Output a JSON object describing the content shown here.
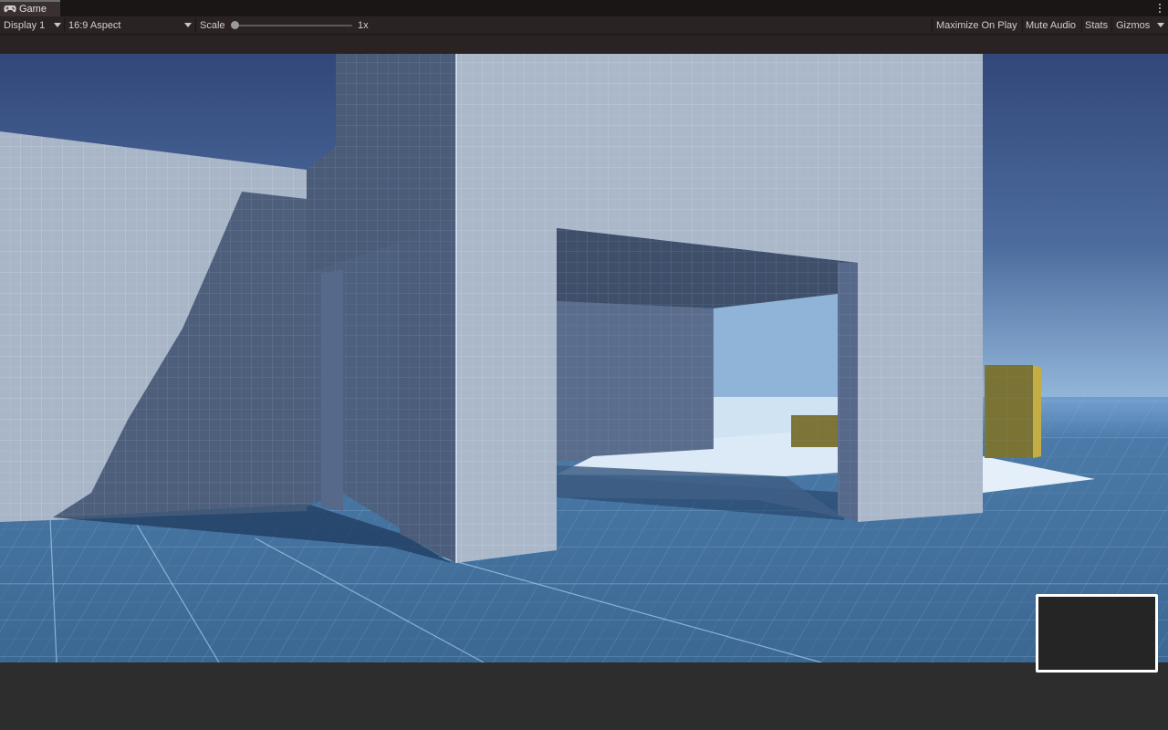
{
  "tab": {
    "title": "Game",
    "icon": "gamepad-icon"
  },
  "toolbar": {
    "display": "Display 1",
    "aspect": "16:9 Aspect",
    "scale_label": "Scale",
    "scale_value": "1x",
    "scale_fraction": 0.0,
    "maximize": "Maximize On Play",
    "mute": "Mute Audio",
    "stats": "Stats",
    "gizmos": "Gizmos"
  },
  "colors": {
    "sky_top": "#354c7e",
    "sky_horizon": "#8fb4d8",
    "floor": "#3f6e99",
    "wall_light": "#a9b6c8",
    "wall_shadow": "#4a5a76",
    "accent_yellow": "#9a8a3a"
  }
}
